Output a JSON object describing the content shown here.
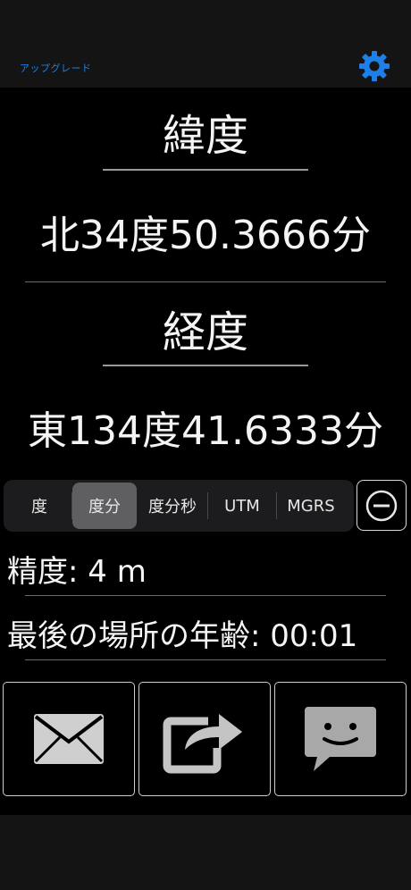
{
  "header": {
    "upgrade_label": "アップグレード",
    "settings_icon": "gear-icon",
    "accent_color": "#1e7fe8"
  },
  "latitude": {
    "title": "緯度",
    "value": "北34度50.3666分"
  },
  "longitude": {
    "title": "経度",
    "value": "東134度41.6333分"
  },
  "format_selector": {
    "options": [
      "度",
      "度分",
      "度分秒",
      "UTM",
      "MGRS"
    ],
    "selected": "度分"
  },
  "minus_button_icon": "minus-circle-icon",
  "accuracy_text": "精度: 4 m",
  "last_location_age_text": "最後の場所の年齢: 00:01",
  "actions": {
    "email_icon": "envelope-icon",
    "share_icon": "share-icon",
    "message_icon": "chat-bubble-icon"
  }
}
